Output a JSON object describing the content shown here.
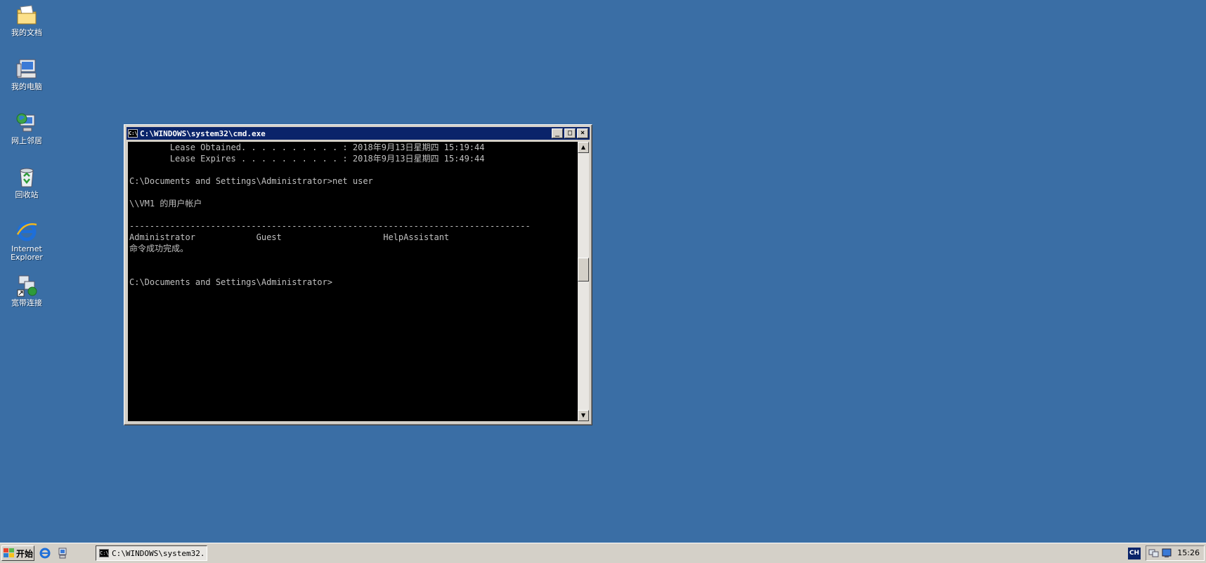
{
  "desktop": {
    "icons": [
      {
        "label": "我的文档",
        "icon": "my-documents-icon"
      },
      {
        "label": "我的电脑",
        "icon": "my-computer-icon"
      },
      {
        "label": "网上邻居",
        "icon": "network-places-icon"
      },
      {
        "label": "回收站",
        "icon": "recycle-bin-icon"
      },
      {
        "label": "Internet\nExplorer",
        "icon": "internet-explorer-icon"
      },
      {
        "label": "宽带连接",
        "icon": "broadband-connection-icon"
      }
    ]
  },
  "window": {
    "title": "C:\\WINDOWS\\system32\\cmd.exe",
    "buttons": {
      "minimize": "_",
      "maximize": "□",
      "close": "×"
    },
    "console_lines": [
      "        Lease Obtained. . . . . . . . . . : 2018年9月13日星期四 15:19:44",
      "        Lease Expires . . . . . . . . . . : 2018年9月13日星期四 15:49:44",
      "",
      "C:\\Documents and Settings\\Administrator>net user",
      "",
      "\\\\VM1 的用户帐户",
      "",
      "-------------------------------------------------------------------------------",
      "Administrator            Guest                    HelpAssistant",
      "命令成功完成。",
      "",
      "",
      "C:\\Documents and Settings\\Administrator>"
    ]
  },
  "taskbar": {
    "start_label": "开始",
    "task_button_label": "C:\\WINDOWS\\system32...",
    "language": "CH",
    "clock": "15:26"
  },
  "colors": {
    "desktop": "#3a6ea5",
    "titlebar": "#0a246a",
    "console_bg": "#000000",
    "console_text": "#c0c0c0",
    "face": "#d4d0c8"
  }
}
